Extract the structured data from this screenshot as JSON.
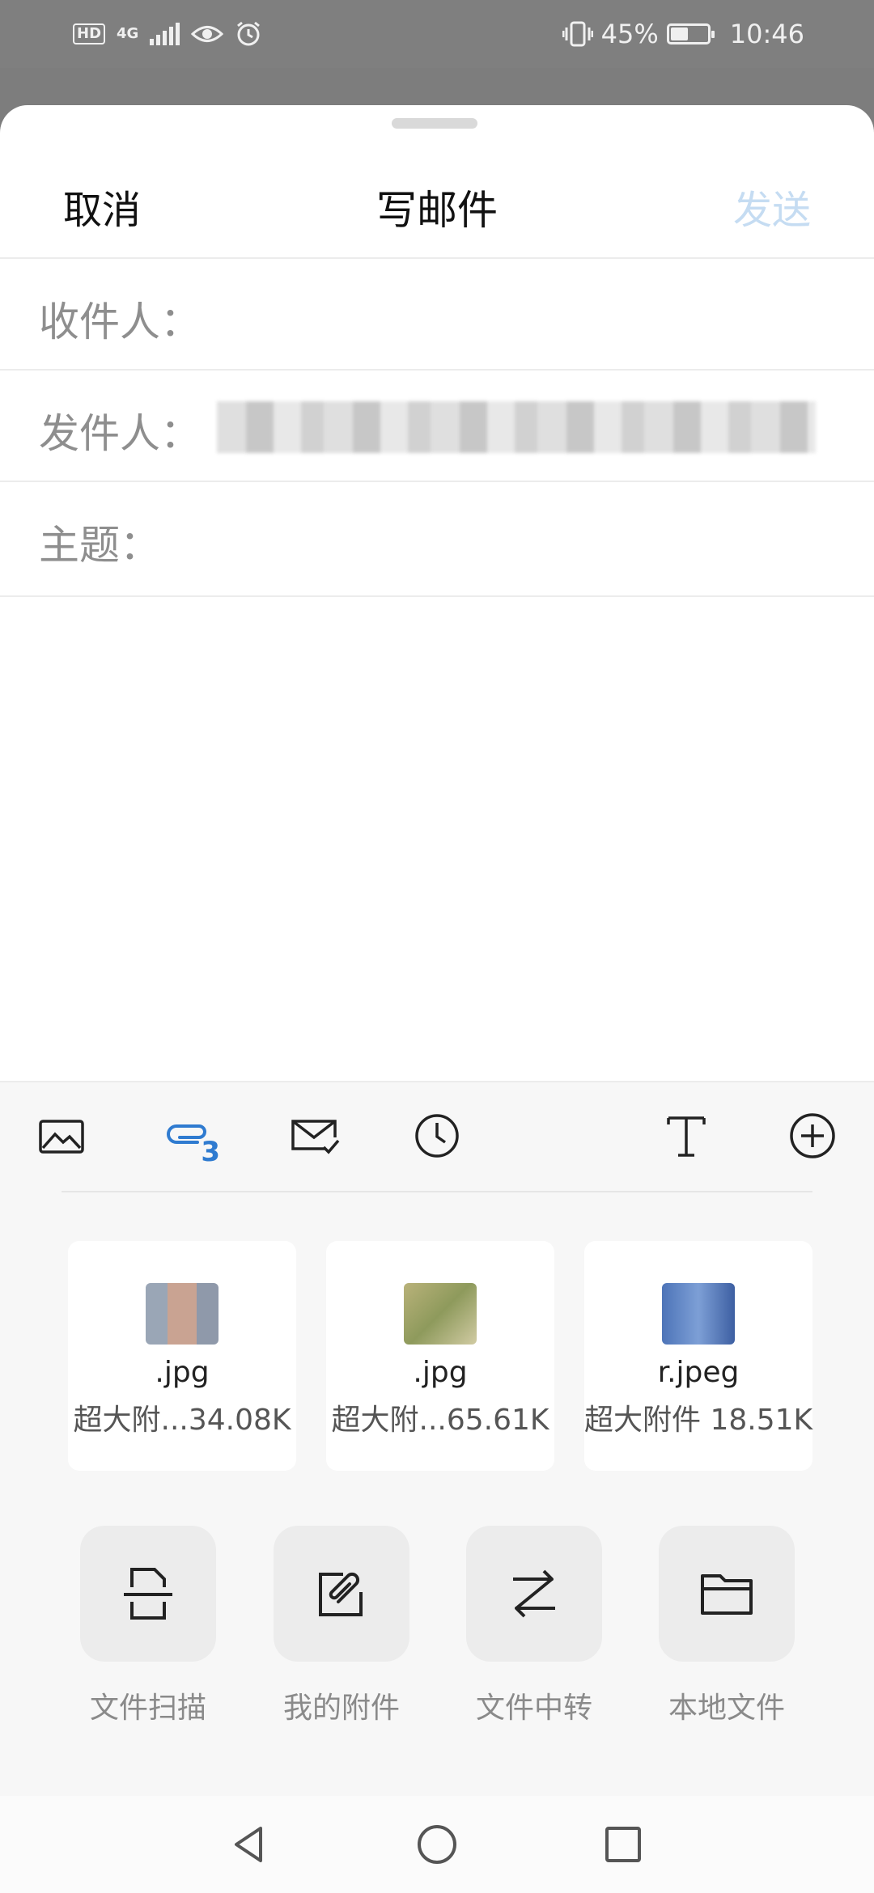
{
  "status_bar": {
    "hd_badge": "HD",
    "network": "4G",
    "battery_percent": "45%",
    "time": "10:46",
    "battery_level": 0.45
  },
  "header": {
    "cancel_label": "取消",
    "title": "写邮件",
    "send_label": "发送"
  },
  "fields": {
    "to_label": "收件人：",
    "from_label": "发件人：",
    "subject_label": "主题："
  },
  "toolbar": {
    "attachment_count": "3",
    "icons": [
      "image-icon",
      "attachment-icon",
      "mail-check-icon",
      "clock-icon",
      "text-format-icon",
      "add-circle-icon"
    ]
  },
  "attachments": [
    {
      "name": ".jpg",
      "meta": "超大附...34.08K"
    },
    {
      "name": ".jpg",
      "meta": "超大附...65.61K"
    },
    {
      "name": "r.jpeg",
      "meta": "超大附件 18.51K"
    }
  ],
  "actions": [
    {
      "label": "文件扫描",
      "icon": "scan-file-icon"
    },
    {
      "label": "我的附件",
      "icon": "my-attachments-icon"
    },
    {
      "label": "文件中转",
      "icon": "file-transfer-icon"
    },
    {
      "label": "本地文件",
      "icon": "folder-icon"
    }
  ],
  "colors": {
    "accent": "#2f7bd0",
    "send_disabled": "#c5dcf2"
  }
}
